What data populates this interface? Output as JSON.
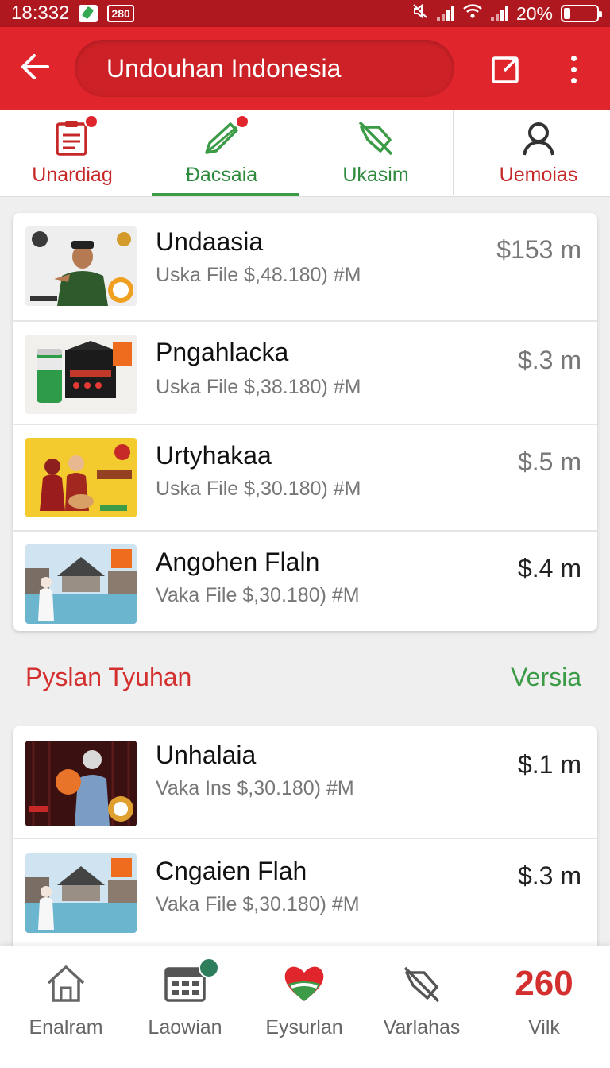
{
  "status_bar": {
    "time": "18:332",
    "badge": "280",
    "battery": "20%"
  },
  "app_bar": {
    "title": "Undouhan Indonesia"
  },
  "tabs": [
    {
      "label": "Unardiag",
      "icon": "clipboard-icon"
    },
    {
      "label": "Đacsaia",
      "icon": "pen-icon",
      "active": true
    },
    {
      "label": "Ukasim",
      "icon": "slash-tag-icon"
    },
    {
      "label": "Uemoias",
      "icon": "person-icon"
    }
  ],
  "list1": [
    {
      "title": "Undaasia",
      "subtitle": "Uska File $,48.180) #M",
      "price": "$153 m"
    },
    {
      "title": "Pngahlacka",
      "subtitle": "Uska File $,38.180) #M",
      "price": "$.3 m"
    },
    {
      "title": "Urtyhakaa",
      "subtitle": "Uska File $,30.180) #M",
      "price": "$.5 m"
    },
    {
      "title": "Angohen Flaln",
      "subtitle": "Vaka File $,30.180) #M",
      "price": "$.4 m"
    }
  ],
  "section": {
    "title": "Pyslan Tyuhan",
    "action": "Versia"
  },
  "list2": [
    {
      "title": "Unhalaia",
      "subtitle": "Vaka Ins  $,30.180) #M",
      "price": "$.1 m"
    },
    {
      "title": "Cngaien Flah",
      "subtitle": "Vaka File $,30.180) #M",
      "price": "$.3 m"
    }
  ],
  "bottom_nav": [
    {
      "label": "Enalram",
      "icon": "home-icon"
    },
    {
      "label": "Laowian",
      "icon": "calendar-icon"
    },
    {
      "label": "Eysurlan",
      "icon": "heart-icon"
    },
    {
      "label": "Varlahas",
      "icon": "slash-tag-icon"
    },
    {
      "label": "Vilk",
      "count": "260"
    }
  ],
  "colors": {
    "primary": "#e0262c",
    "status_bar": "#b0181f",
    "accent_green": "#3c9b46"
  }
}
